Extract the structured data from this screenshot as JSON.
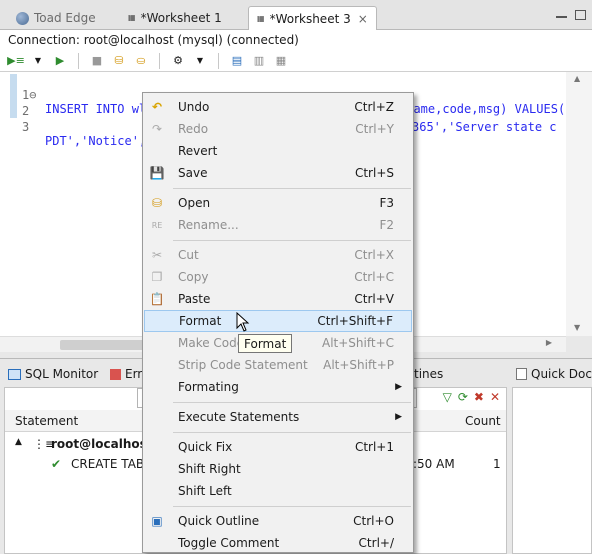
{
  "tabs": [
    {
      "label": "Toad Edge",
      "icon": "globe-icon"
    },
    {
      "label": "*Worksheet 1",
      "icon": "sql-icon"
    },
    {
      "label": "*Worksheet 3",
      "icon": "sql-icon",
      "close": "×"
    }
  ],
  "connection": "Connection: root@localhost (mysql) (connected)",
  "editor": {
    "lines": [
      {
        "num": "1",
        "fold": "⊖",
        "text": "INSERT INTO wlslog(time_stamp,category,type,servername,code,msg) VALUES('"
      },
      {
        "num": "2",
        "fold": "",
        "text": ""
      },
      {
        "num": "3",
        "fold": "",
        "text": "PDT','Notice',"
      },
      {
        "num": "",
        "fold": "",
        "text": "365','Server state c"
      }
    ]
  },
  "context_menu": {
    "items": [
      {
        "label": "Undo",
        "shortcut": "Ctrl+Z",
        "icon": "undo-icon",
        "disabled": false
      },
      {
        "label": "Redo",
        "shortcut": "Ctrl+Y",
        "icon": "redo-icon",
        "disabled": true
      },
      {
        "label": "Revert",
        "shortcut": "",
        "icon": "",
        "disabled": false
      },
      {
        "label": "Save",
        "shortcut": "Ctrl+S",
        "icon": "save-icon",
        "disabled": false
      },
      {
        "label": "Open",
        "shortcut": "F3",
        "icon": "open-icon",
        "disabled": false
      },
      {
        "label": "Rename...",
        "shortcut": "F2",
        "icon": "rename-icon",
        "disabled": true
      },
      {
        "label": "Cut",
        "shortcut": "Ctrl+X",
        "icon": "cut-icon",
        "disabled": true
      },
      {
        "label": "Copy",
        "shortcut": "Ctrl+C",
        "icon": "copy-icon",
        "disabled": true
      },
      {
        "label": "Paste",
        "shortcut": "Ctrl+V",
        "icon": "paste-icon",
        "disabled": false
      },
      {
        "label": "Format",
        "shortcut": "Ctrl+Shift+F",
        "icon": "",
        "disabled": false
      },
      {
        "label": "Make Code",
        "shortcut": "Alt+Shift+C",
        "icon": "",
        "disabled": true
      },
      {
        "label": "Strip Code Statement",
        "shortcut": "Alt+Shift+P",
        "icon": "",
        "disabled": true
      },
      {
        "label": "Formating",
        "shortcut": "",
        "icon": "",
        "disabled": false
      },
      {
        "label": "Execute Statements",
        "shortcut": "",
        "icon": "",
        "disabled": false
      },
      {
        "label": "Quick Fix",
        "shortcut": "Ctrl+1",
        "icon": "",
        "disabled": false
      },
      {
        "label": "Shift Right",
        "shortcut": "",
        "icon": "",
        "disabled": false
      },
      {
        "label": "Shift Left",
        "shortcut": "",
        "icon": "",
        "disabled": false
      },
      {
        "label": "Quick Outline",
        "shortcut": "Ctrl+O",
        "icon": "outline-icon",
        "disabled": false
      },
      {
        "label": "Toggle Comment",
        "shortcut": "Ctrl+/",
        "icon": "",
        "disabled": false
      }
    ],
    "make_code_tail": "t",
    "submenu_arrow": "▶"
  },
  "tooltip": "Format",
  "bottom": {
    "tabs": [
      "SQL Monitor",
      "Erro",
      "tines",
      "Quick Doc"
    ],
    "table": {
      "col_statement": "Statement",
      "col_count": "Count",
      "group": "root@localhost (",
      "group_toggle": "▲",
      "row_statement": "CREATE TABL",
      "row_time": ":50 AM",
      "row_count": "1"
    }
  },
  "colors": {
    "keyword": "#2a2af0",
    "highlight": "#dcecfb"
  }
}
